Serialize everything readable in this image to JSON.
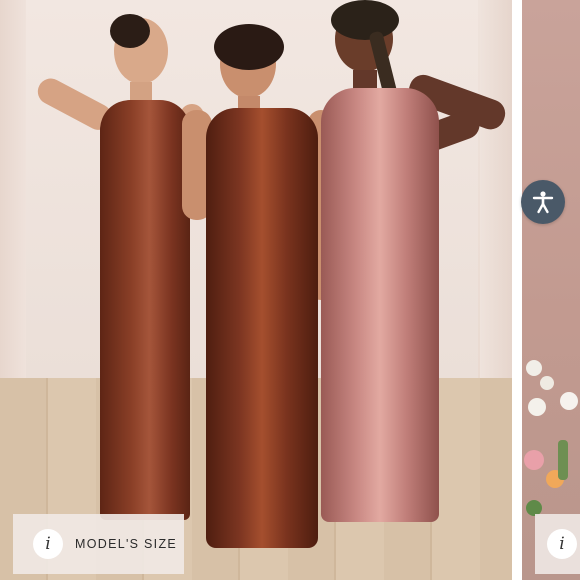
{
  "gallery": {
    "main_image": {
      "alt": ""
    },
    "model_size_button": {
      "label": "MODEL'S SIZE",
      "info_glyph": "i"
    },
    "next_image": {
      "info_glyph": "i"
    },
    "accessibility": {
      "icon": "accessibility-person-icon",
      "color": "#4a5968"
    }
  },
  "colors": {
    "dress_rust": "#8a3f27",
    "dress_copper": "#7c3521",
    "dress_rose": "#c98883",
    "backdrop": "#efe3dc"
  }
}
